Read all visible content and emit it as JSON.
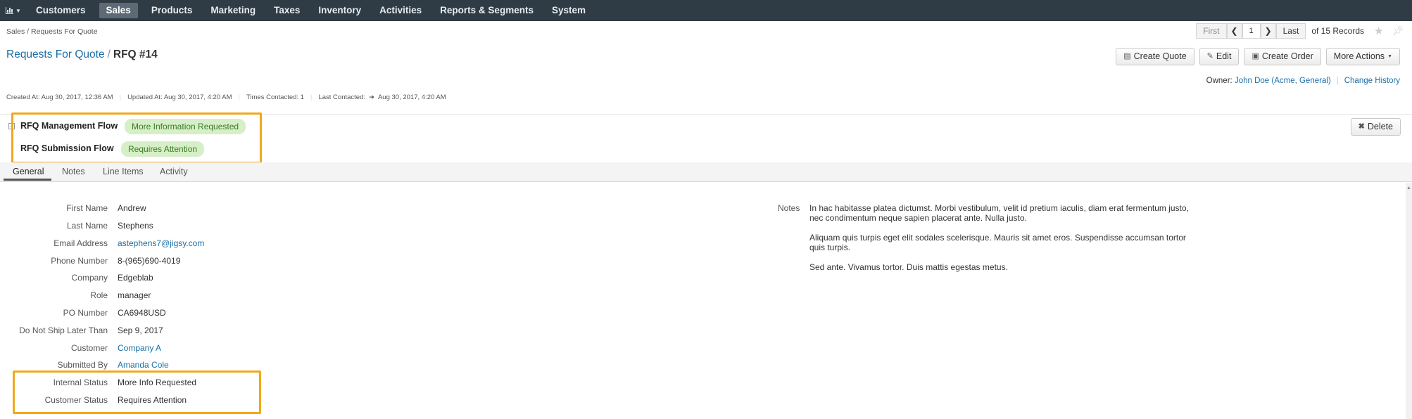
{
  "nav": {
    "logo_icon": "bar-chart-icon",
    "items": [
      {
        "label": "Customers",
        "active": false
      },
      {
        "label": "Sales",
        "active": true
      },
      {
        "label": "Products",
        "active": false
      },
      {
        "label": "Marketing",
        "active": false
      },
      {
        "label": "Taxes",
        "active": false
      },
      {
        "label": "Inventory",
        "active": false
      },
      {
        "label": "Activities",
        "active": false
      },
      {
        "label": "Reports & Segments",
        "active": false
      },
      {
        "label": "System",
        "active": false
      }
    ]
  },
  "breadcrumb": "Sales / Requests For Quote",
  "pager": {
    "first": "First",
    "page": "1",
    "last": "Last",
    "of": "of 15 Records"
  },
  "title": {
    "parent": "Requests For Quote",
    "separator": "/",
    "current": "RFQ #14"
  },
  "actions": {
    "create_quote": "Create Quote",
    "edit": "Edit",
    "create_order": "Create Order",
    "more_actions": "More Actions"
  },
  "meta": {
    "created": "Created At: Aug 30, 2017, 12:36 AM",
    "updated": "Updated At: Aug 30, 2017, 4:20 AM",
    "times_contacted": "Times Contacted: 1",
    "last_contacted_label": "Last Contacted:",
    "last_contacted_value": "Aug 30, 2017, 4:20 AM"
  },
  "owner": {
    "label": "Owner:",
    "name": "John Doe (Acme, General)",
    "change_history": "Change History"
  },
  "flows": [
    {
      "label": "RFQ Management Flow",
      "status": "More Information Requested"
    },
    {
      "label": "RFQ Submission Flow",
      "status": "Requires Attention"
    }
  ],
  "delete_label": "Delete",
  "tabs": [
    "General",
    "Notes",
    "Line Items",
    "Activity"
  ],
  "fields": [
    {
      "label": "First Name",
      "value": "Andrew",
      "link": false
    },
    {
      "label": "Last Name",
      "value": "Stephens",
      "link": false
    },
    {
      "label": "Email Address",
      "value": "astephens7@jigsy.com",
      "link": true
    },
    {
      "label": "Phone Number",
      "value": "8-(965)690-4019",
      "link": false
    },
    {
      "label": "Company",
      "value": "Edgeblab",
      "link": false
    },
    {
      "label": "Role",
      "value": "manager",
      "link": false
    },
    {
      "label": "PO Number",
      "value": "CA6948USD",
      "link": false
    },
    {
      "label": "Do Not Ship Later Than",
      "value": "Sep 9, 2017",
      "link": false
    },
    {
      "label": "Customer",
      "value": "Company A",
      "link": true
    },
    {
      "label": "Submitted By",
      "value": "Amanda Cole",
      "link": true
    },
    {
      "label": "Internal Status",
      "value": "More Info Requested",
      "link": false
    },
    {
      "label": "Customer Status",
      "value": "Requires Attention",
      "link": false
    }
  ],
  "notes": {
    "label": "Notes",
    "paragraphs": [
      "In hac habitasse platea dictumst. Morbi vestibulum, velit id pretium iaculis, diam erat fermentum justo, nec condimentum neque sapien placerat ante. Nulla justo.",
      "Aliquam quis turpis eget elit sodales scelerisque. Mauris sit amet eros. Suspendisse accumsan tortor quis turpis.",
      "Sed ante. Vivamus tortor. Duis mattis egestas metus."
    ]
  },
  "colors": {
    "highlight": "#f0a81e",
    "link": "#1a6ea6",
    "badge_bg": "#d6efc6",
    "badge_text": "#3a7a29",
    "nav_bg": "#2f3b45"
  }
}
